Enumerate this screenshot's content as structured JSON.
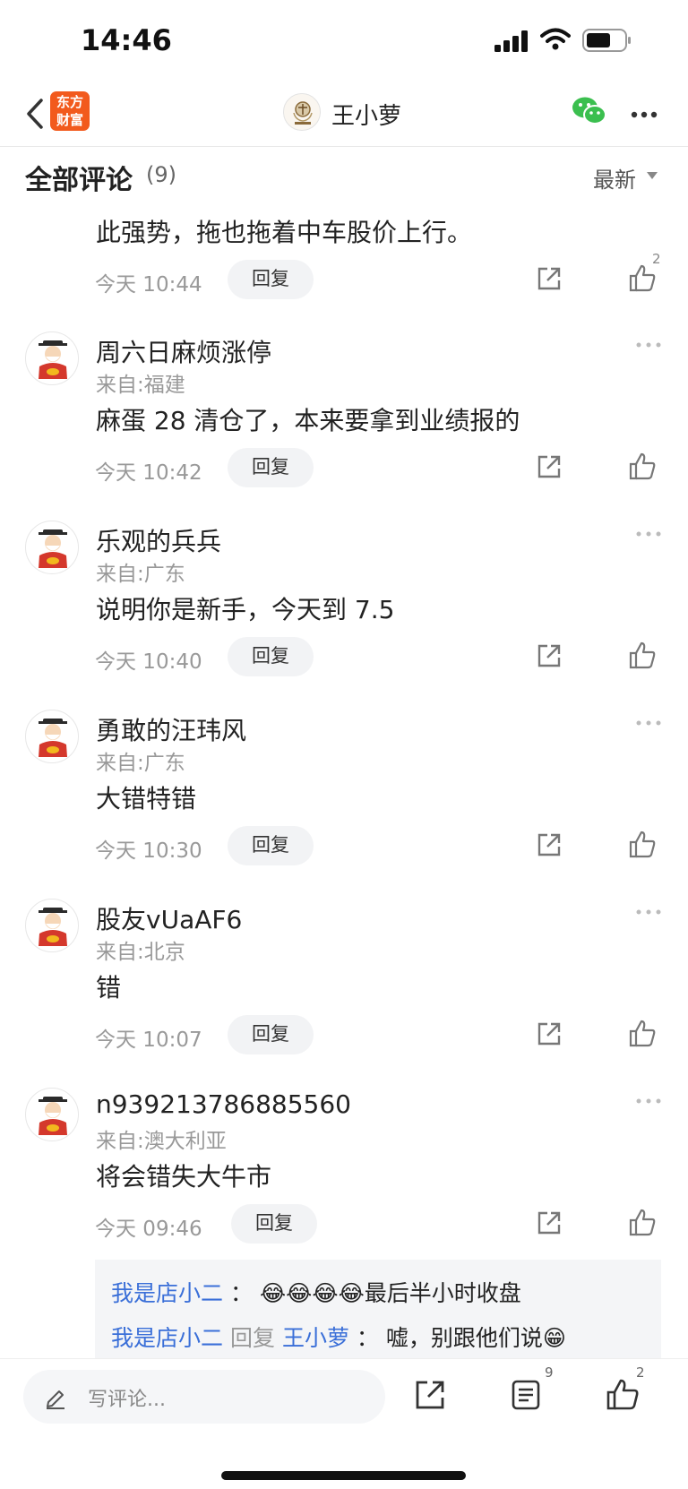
{
  "status": {
    "time": "14:46"
  },
  "nav": {
    "logo_line1": "东方",
    "logo_line2": "财富",
    "title": "王小萝",
    "icons": [
      "back-chevron-icon",
      "wechat-icon",
      "more-icon"
    ]
  },
  "comments_header": {
    "title": "全部评论",
    "count": "(9)",
    "sort": "最新"
  },
  "partial_comment": {
    "text": "此强势，拖也拖着中车股价上行。",
    "time": "今天 10:44",
    "reply": "回复",
    "likes": "2"
  },
  "comments": [
    {
      "name": "周六日麻烦涨停",
      "loc": "来自:福建",
      "text": "麻蛋 28 清仓了，本来要拿到业绩报的",
      "time": "今天 10:42",
      "reply": "回复"
    },
    {
      "name": "乐观的兵兵",
      "loc": "来自:广东",
      "text": "说明你是新手，今天到 7.5",
      "time": "今天 10:40",
      "reply": "回复"
    },
    {
      "name": "勇敢的汪玮风",
      "loc": "来自:广东",
      "text": "大错特错",
      "time": "今天 10:30",
      "reply": "回复"
    },
    {
      "name": "股友vUaAF6",
      "loc": "来自:北京",
      "text": "错",
      "time": "今天 10:07",
      "reply": "回复"
    },
    {
      "name": "n939213786885560",
      "loc": "来自:澳大利亚",
      "text": "将会错失大牛市",
      "time": "今天 09:46",
      "reply": "回复"
    }
  ],
  "replies": {
    "r1_user": "我是店小二",
    "r1_sep": "：",
    "r1_emoji": "😂😂😂😂",
    "r1_text": "最后半小时收盘",
    "r2_user": "我是店小二",
    "r2_mid": "回复",
    "r2_target": "王小萝",
    "r2_sep": "：",
    "r2_text": "嘘，别跟他们说😁"
  },
  "bottom": {
    "placeholder": "写评论...",
    "list_count": "9",
    "like_count": "2"
  },
  "colors": {
    "brand_orange": "#f25a1d",
    "link_blue": "#3a6fd8",
    "wechat_green": "#3bbf4f"
  }
}
